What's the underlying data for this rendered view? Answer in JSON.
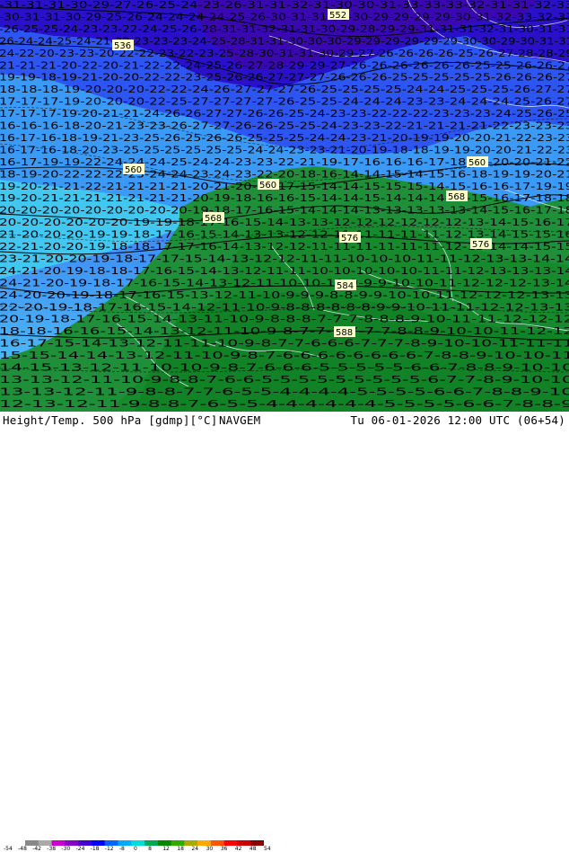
{
  "footer": {
    "title": "Height/Temp. 500 hPa [gdmp][°C]",
    "model": "NAVGEM",
    "valid_time": "Tu 06-01-2026 12:00 UTC (06+54)"
  },
  "colorbar": {
    "labels": [
      "-54",
      "-48",
      "-42",
      "-38",
      "-30",
      "-24",
      "-18",
      "-12",
      "-8",
      "0",
      "8",
      "12",
      "18",
      "24",
      "30",
      "36",
      "42",
      "48",
      "54"
    ],
    "colors": [
      "#888888",
      "#aaaaaa",
      "#cc00cc",
      "#8800cc",
      "#4400cc",
      "#0000ff",
      "#0066ff",
      "#00aaff",
      "#00dddd",
      "#00aa55",
      "#008800",
      "#33aa00",
      "#aaaa00",
      "#ffaa00",
      "#ff5500",
      "#ff0000",
      "#cc0000",
      "#880000"
    ]
  },
  "height_labels": [
    "560",
    "560",
    "560",
    "568",
    "568",
    "576",
    "576",
    "584",
    "588",
    "552",
    "536"
  ],
  "temp_rows": [
    "-31-31-31-30-29-27-26-25-24-23-26-31-31-32-31-30-30-31-33-33-33-32-31-31-32-33",
    "-30-31-31-30-29-25-26-24-24-24-24-25-26-30-31-31-31-30-29-29-29-29-30-31-32-33-32-33",
    "-26-25-25-24-23-23-22-24-25-26-28-31-31-32-31-31-30-29-28-29-29-31-31-31-32-31-30-31-31",
    "26-24-24-25-24-21-22-23-23-23-24-25-28-31-31-30-30-30-29-29-29-29-29-29-30-30-29-30-31-31",
    "24-22-20-23-23-20-22-22-23-22-23-25-28-30-31-31-30-29-27-26-26-26-26-25-26-27-28-28-29",
    "21-21-21-20-22-20-21-22-22-24-25-26-27-28-29-29-27-26-26-26-26-26-26-25-25-26-26-27",
    "19-19-18-19-21-20-20-22-22-23-25-26-26-27-27-27-26-26-26-25-25-25-25-25-26-26-26-27",
    "18-18-18-19-20-20-20-22-22-24-26-27-27-27-26-25-25-25-25-24-24-25-25-25-26-27-27",
    "17-17-17-19-20-20-20-22-25-27-27-27-27-26-25-25-24-24-24-23-23-24-24-24-25-26-27",
    "17-17-17-19-20-21-21-24-26-26-27-27-26-26-25-24-23-23-22-22-22-23-23-23-24-25-26-25",
    "16-16-16-18-20-21-23-23-26-27-27-26-26-25-25-24-23-23-22-21-21-21-21-22-23-23-23",
    "16-17-16-18-19-21-23-25-26-25-26-26-25-25-25-24-24-23-21-20-19-19-20-20-21-22-23-23",
    "16-17-16-18-20-23-25-25-25-25-25-25-24-24-23-23-21-20-19-18-18-19-19-20-20-21-22-23",
    "16-17-19-19-22-24-24-24-25-24-24-23-23-22-21-19-17-16-16-16-17-18-19-20-20-21-22",
    "18-19-20-22-22-22-23-24-24-23-24-23-22-20-18-16-14-14-15-14-15-16-18-19-19-20-21",
    "19-20-21-21-22-21-21-21-21-20-21-20-18-17-15-14-14-15-15-15-14-15-16-16-17-19-19",
    "19-20-21-21-21-21-21-21-21-20-19-18-16-16-15-14-14-15-14-14-14-14-15-16-17-18-18",
    "20-20-20-20-20-20-20-20-20-19-18-17-16-15-14-14-14-13-13-13-13-13-14-15-16-17-18",
    "20-20-20-20-20-20-19-19-18-17-16-15-14-13-13-12-12-12-12-12-12-13-14-15-16-17",
    "21-20-20-20-19-19-18-17-16-15-14-13-13-12-12-11-11-11-11-11-12-13-14-15-15-16",
    "22-21-20-20-19-18-18-17-17-16-14-13-12-12-11-11-11-11-11-11-12-13-14-14-15-15",
    "23-21-20-20-19-18-17-17-15-14-13-12-12-11-11-10-10-10-11-11-12-13-13-14-14",
    "24-21-20-19-18-18-17-16-15-14-13-12-11-11-10-10-10-10-10-11-11-12-13-13-13-14",
    "24-21-20-19-18-17-16-15-14-13-12-11-10-10-10-9-9-9-10-10-11-12-12-12-13-14",
    "24-20-20-19-18-17-16-15-13-12-11-10-9-9-9-8-8-9-9-10-10-11-12-12-12-13-13",
    "22-20-19-18-17-16-15-14-12-11-10-9-8-8-8-8-8-8-9-9-10-11-11-12-12-13-13",
    "20-19-18-17-16-15-14-13-11-10-9-8-8-8-7-7-7-8-8-8-9-10-11-11-12-12-12",
    "18-18-16-16-15-14-13-12-11-10-9-8-7-7-7-7-7-7-8-8-9-10-10-11-12-12",
    "16-17-15-14-13-12-11-11-10-9-8-7-7-6-6-6-7-7-7-8-9-10-10-11-11-11",
    "15-15-14-14-13-12-11-10-9-8-7-6-6-6-6-6-6-6-6-7-8-8-9-10-10-11",
    "14-15-13-12-11-10-10-9-8-7-6-6-6-5-5-5-5-5-6-6-7-8-8-9-10-10",
    "13-13-12-11-10-9-8-8-7-6-6-5-5-5-5-5-5-5-5-5-6-7-7-8-9-10-10",
    "13-13-12-11-9-8-8-7-7-6-5-5-4-4-4-4-5-5-5-5-6-6-7-8-8-9-10",
    "12-13-12-11-9-8-8-7-6-5-5-4-4-4-4-4-4-5-5-5-5-6-6-7-8-8-9"
  ]
}
